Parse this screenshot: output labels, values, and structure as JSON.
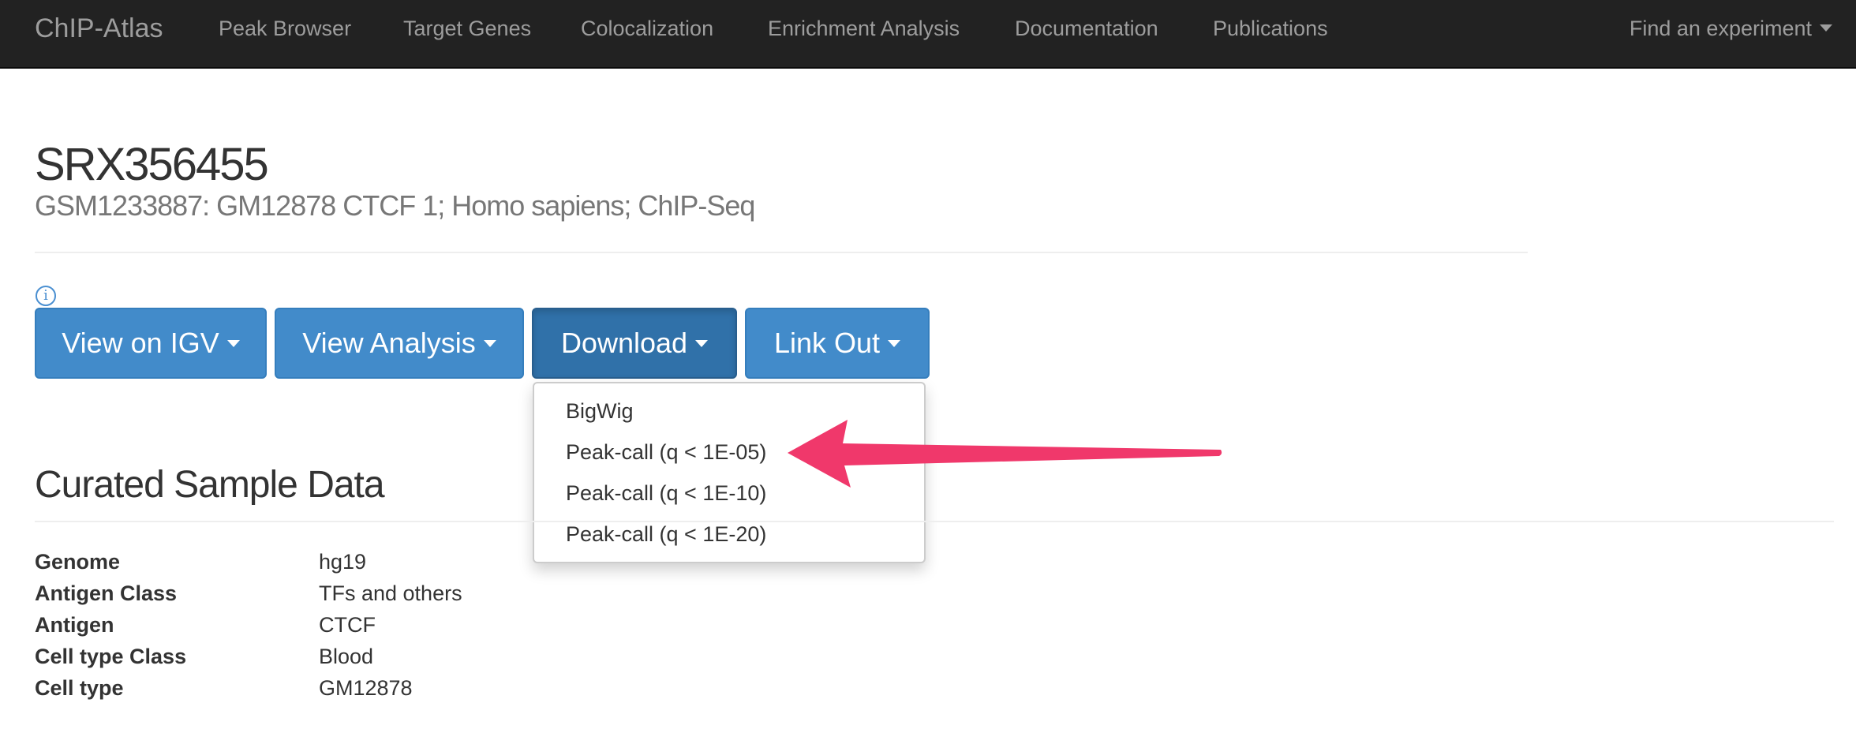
{
  "navbar": {
    "brand": "ChIP-Atlas",
    "links": [
      "Peak Browser",
      "Target Genes",
      "Colocalization",
      "Enrichment Analysis",
      "Documentation",
      "Publications"
    ],
    "find_experiment": "Find an experiment"
  },
  "header": {
    "title": "SRX356455",
    "subtitle": "GSM1233887: GM12878 CTCF 1; Homo sapiens; ChIP-Seq",
    "info_glyph": "i"
  },
  "buttons": [
    "View on IGV",
    "View Analysis",
    "Download",
    "Link Out"
  ],
  "download_menu": {
    "items": [
      "BigWig",
      "Peak-call (q < 1E-05)",
      "Peak-call (q < 1E-10)",
      "Peak-call (q < 1E-20)"
    ]
  },
  "curated": {
    "title": "Curated Sample Data",
    "rows": [
      {
        "label": "Genome",
        "value": "hg19"
      },
      {
        "label": "Antigen Class",
        "value": "TFs and others"
      },
      {
        "label": "Antigen",
        "value": "CTCF"
      },
      {
        "label": "Cell type Class",
        "value": "Blood"
      },
      {
        "label": "Cell type",
        "value": "GM12878"
      }
    ]
  },
  "colors": {
    "navbar_bg": "#222222",
    "button_blue": "#428bca",
    "button_active": "#3071a9",
    "annotation_arrow": "#f0386b"
  }
}
